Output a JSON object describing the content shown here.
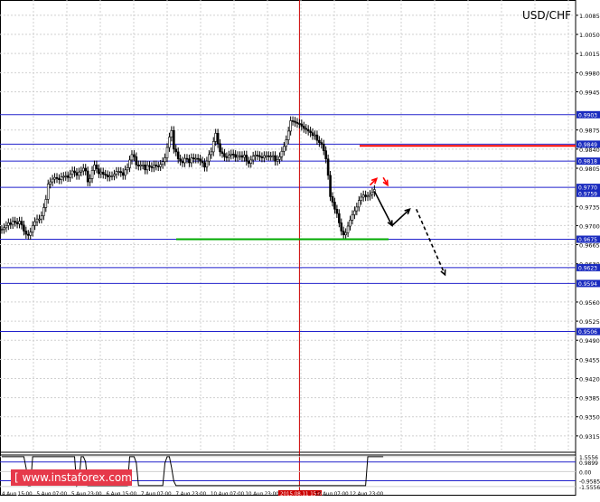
{
  "chart_data": {
    "type": "candlestick",
    "symbol": "USD/CHF",
    "watermark": "[ www.instaforex.com ]",
    "ylim": [
      0.9285,
      1.0113
    ],
    "y_ticks": [
      "1.0085",
      "1.0050",
      "1.0015",
      "0.9980",
      "0.9945",
      "0.9875",
      "0.9840",
      "0.9805",
      "0.9735",
      "0.9700",
      "0.9665",
      "0.9630",
      "0.9560",
      "0.9525",
      "0.9490",
      "0.9455",
      "0.9420",
      "0.9385",
      "0.9350",
      "0.9315"
    ],
    "levels": [
      {
        "price": 0.9903,
        "label": "0.9903"
      },
      {
        "price": 0.9849,
        "label": "0.9849"
      },
      {
        "price": 0.9818,
        "label": "0.9818"
      },
      {
        "price": 0.977,
        "label": "0.9770"
      },
      {
        "price": 0.9759,
        "label": "0.9759",
        "style": "tag"
      },
      {
        "price": 0.9675,
        "label": "0.9675"
      },
      {
        "price": 0.9623,
        "label": "0.9623"
      },
      {
        "price": 0.9594,
        "label": "0.9594"
      },
      {
        "price": 0.9506,
        "label": "0.9506"
      }
    ],
    "x_ticks": [
      "4 Aug 15:00",
      "5 Aug 07:00",
      "5 Aug 23:00",
      "6 Aug 15:00",
      "7 Aug 07:00",
      "7 Aug 23:00",
      "10 Aug 07:00",
      "10 Aug 23:00",
      "2015.08.11 15:00",
      "12 Aug 07:00",
      "12 Aug 23:00"
    ],
    "highlighted_x_tick": "2015.08.11 15:00",
    "close_prices": [
      0.9693,
      0.9696,
      0.97,
      0.9705,
      0.9702,
      0.9708,
      0.9706,
      0.9703,
      0.9708,
      0.9701,
      0.969,
      0.9684,
      0.9682,
      0.9688,
      0.97,
      0.9707,
      0.9712,
      0.9712,
      0.9718,
      0.9733,
      0.9748,
      0.9776,
      0.978,
      0.9785,
      0.9788,
      0.9786,
      0.9784,
      0.9789,
      0.979,
      0.9791,
      0.9788,
      0.9794,
      0.98,
      0.9797,
      0.9792,
      0.9798,
      0.98,
      0.9805,
      0.98,
      0.978,
      0.9786,
      0.9801,
      0.9811,
      0.9804,
      0.9795,
      0.9798,
      0.9794,
      0.9793,
      0.9789,
      0.9791,
      0.9791,
      0.9794,
      0.9799,
      0.9799,
      0.9797,
      0.9792,
      0.9802,
      0.9806,
      0.982,
      0.983,
      0.9826,
      0.9811,
      0.9809,
      0.9811,
      0.9811,
      0.9802,
      0.981,
      0.9808,
      0.9806,
      0.9811,
      0.9809,
      0.9808,
      0.9812,
      0.9817,
      0.9824,
      0.9843,
      0.9862,
      0.9874,
      0.984,
      0.9835,
      0.9822,
      0.9818,
      0.9815,
      0.9823,
      0.9822,
      0.9815,
      0.9824,
      0.9822,
      0.9823,
      0.9822,
      0.9818,
      0.9815,
      0.9807,
      0.9818,
      0.983,
      0.9835,
      0.9854,
      0.9869,
      0.985,
      0.9835,
      0.9832,
      0.9826,
      0.9825,
      0.9829,
      0.9831,
      0.983,
      0.9825,
      0.9828,
      0.9828,
      0.9825,
      0.9829,
      0.9818,
      0.9814,
      0.982,
      0.9827,
      0.9829,
      0.9828,
      0.9826,
      0.9824,
      0.9828,
      0.9828,
      0.9827,
      0.9827,
      0.9828,
      0.9818,
      0.9821,
      0.9826,
      0.9836,
      0.9845,
      0.9857,
      0.9873,
      0.9892,
      0.9891,
      0.9889,
      0.9887,
      0.9886,
      0.9882,
      0.9878,
      0.9876,
      0.9873,
      0.987,
      0.9865,
      0.9866,
      0.9856,
      0.9852,
      0.9849,
      0.9837,
      0.9822,
      0.9792,
      0.9753,
      0.9743,
      0.973,
      0.9722,
      0.9705,
      0.969,
      0.9683,
      0.9687,
      0.9699,
      0.971,
      0.972,
      0.9727,
      0.9734,
      0.9746,
      0.9752,
      0.9756,
      0.9753,
      0.9754,
      0.9757,
      0.9761,
      0.9766
    ],
    "forecast_arrows": [
      {
        "color": "#000000",
        "style": "solid",
        "points": [
          [
            0.9763,
            0
          ],
          [
            0.97,
            8
          ]
        ]
      },
      {
        "color": "#000000",
        "style": "solid",
        "points": [
          [
            0.97,
            8
          ],
          [
            0.973,
            16
          ]
        ]
      },
      {
        "color": "#000000",
        "style": "dashed",
        "points": [
          [
            0.973,
            19
          ],
          [
            0.961,
            32
          ]
        ]
      },
      {
        "color": "#ff0000",
        "style": "solid",
        "points": [
          [
            0.9774,
            -2
          ],
          [
            0.9786,
            1
          ]
        ]
      },
      {
        "color": "#ff0000",
        "style": "solid",
        "points": [
          [
            0.9788,
            4
          ],
          [
            0.9774,
            6
          ]
        ]
      }
    ],
    "resistance_segment": {
      "price": 0.9846,
      "color": "#ff0000"
    },
    "support_segment": {
      "price": 0.9675,
      "color": "#00aa00"
    },
    "indicator": {
      "levels": [
        {
          "value": 1.5556,
          "label": "1.5556"
        },
        {
          "value": 0.9899,
          "label": "0.9899"
        },
        {
          "value": 0.0,
          "label": "0.00"
        },
        {
          "value": -0.9585,
          "label": "-0.9585"
        },
        {
          "value": -1.5556,
          "label": "-1.5556"
        }
      ],
      "ylim": [
        -1.75,
        1.72
      ],
      "values": [
        1.54,
        1.54,
        1.54,
        1.54,
        1.54,
        1.54,
        1.54,
        1.54,
        1.54,
        1.54,
        1.54,
        0.4,
        -1.46,
        -1.46,
        1.54,
        1.54,
        1.54,
        1.54,
        1.54,
        1.54,
        1.54,
        1.54,
        1.54,
        1.54,
        1.54,
        1.54,
        1.54,
        1.54,
        1.54,
        1.54,
        1.54,
        1.54,
        1.54,
        1.54,
        -1.46,
        -1.0,
        1.54,
        1.54,
        1.0,
        -1.46,
        -1.46,
        -1.46,
        -1.46,
        -1.46,
        -1.46,
        -1.46,
        -1.46,
        -1.46,
        -1.46,
        -1.46,
        -1.46,
        -1.46,
        -1.46,
        -1.46,
        -1.46,
        -1.46,
        -1.46,
        -1.46,
        1.54,
        1.54,
        1.54,
        0.9,
        -1.46,
        -1.46,
        -1.46,
        -1.46,
        -1.46,
        -1.46,
        -1.46,
        -1.46,
        -1.46,
        -1.46,
        -1.46,
        -1.46,
        0.9,
        1.54,
        1.54,
        0.4,
        -1.0,
        -1.46,
        -1.46,
        -1.46,
        -1.46,
        -1.46,
        -1.46,
        -1.46,
        -1.46,
        -1.46,
        -1.46,
        -1.46,
        -1.46,
        -1.46,
        -1.46,
        -1.46,
        -1.46,
        -1.46,
        -1.46,
        -1.46,
        -1.46,
        -1.46,
        -1.46,
        -1.46,
        -1.46,
        -1.46,
        -1.46,
        -1.46,
        -1.46,
        -1.46,
        -1.46,
        -1.46,
        -1.46,
        -1.46,
        -1.46,
        -1.46,
        -1.46,
        -1.46,
        -1.46,
        -1.46,
        -1.46,
        -1.46,
        -1.46,
        -1.46,
        -1.46,
        -1.46,
        -1.46,
        -1.46,
        -1.46,
        -1.46,
        -1.46,
        -1.46,
        -1.46,
        -1.46,
        -1.46,
        -1.46,
        -1.46,
        -1.46,
        -1.46,
        -1.46,
        -1.46,
        -1.46,
        -1.46,
        -1.46,
        -1.46,
        -1.46,
        -1.46,
        -1.46,
        -1.46,
        -1.46,
        -1.46,
        -1.46,
        -1.46,
        -1.46,
        -1.46,
        -1.46,
        -1.46,
        -1.46,
        -1.46,
        -1.46,
        -1.46,
        -1.46,
        -1.46,
        -1.46,
        -1.46,
        -1.46,
        -1.46,
        -1.46,
        1.54,
        1.54,
        1.54,
        1.54,
        1.54,
        1.54,
        1.54,
        1.54
      ]
    },
    "grid": true,
    "colors": {
      "level_line": "#2222cc",
      "candle": "#000000",
      "tag_bg": "#1a2bbf",
      "cursor_line": "#cc0000",
      "resistance": "#ff0000",
      "support": "#00aa00"
    }
  }
}
